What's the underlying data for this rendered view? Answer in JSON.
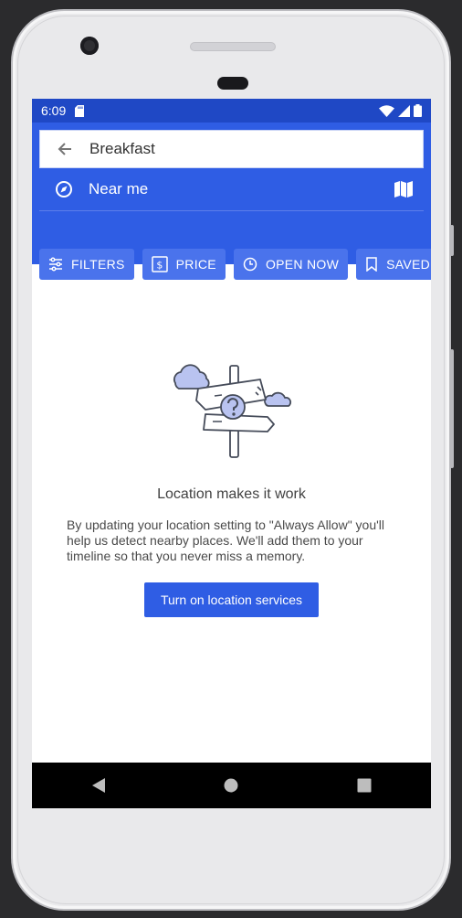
{
  "status_bar": {
    "time": "6:09",
    "icons": [
      "sd-card-icon",
      "wifi-icon",
      "cell-signal-icon",
      "battery-icon"
    ]
  },
  "search": {
    "query": "Breakfast",
    "location": "Near me"
  },
  "filter_chips": [
    {
      "label": "FILTERS",
      "icon": "tune-icon"
    },
    {
      "label": "PRICE",
      "icon": "dollar-icon"
    },
    {
      "label": "OPEN NOW",
      "icon": "clock-icon"
    },
    {
      "label": "SAVED",
      "icon": "bookmark-icon"
    }
  ],
  "empty_state": {
    "title": "Location makes it work",
    "description": "By updating your location setting to \"Always Allow\" you'll help us detect nearby places. We'll add them to your timeline so that you never miss a memory.",
    "button_label": "Turn on location services"
  },
  "colors": {
    "status_bar": "#1f48c5",
    "app_bar": "#2f5de4",
    "chip": "#4a73ec",
    "primary_button": "#2f5de4",
    "illustration_fill": "#b9c3f0"
  }
}
